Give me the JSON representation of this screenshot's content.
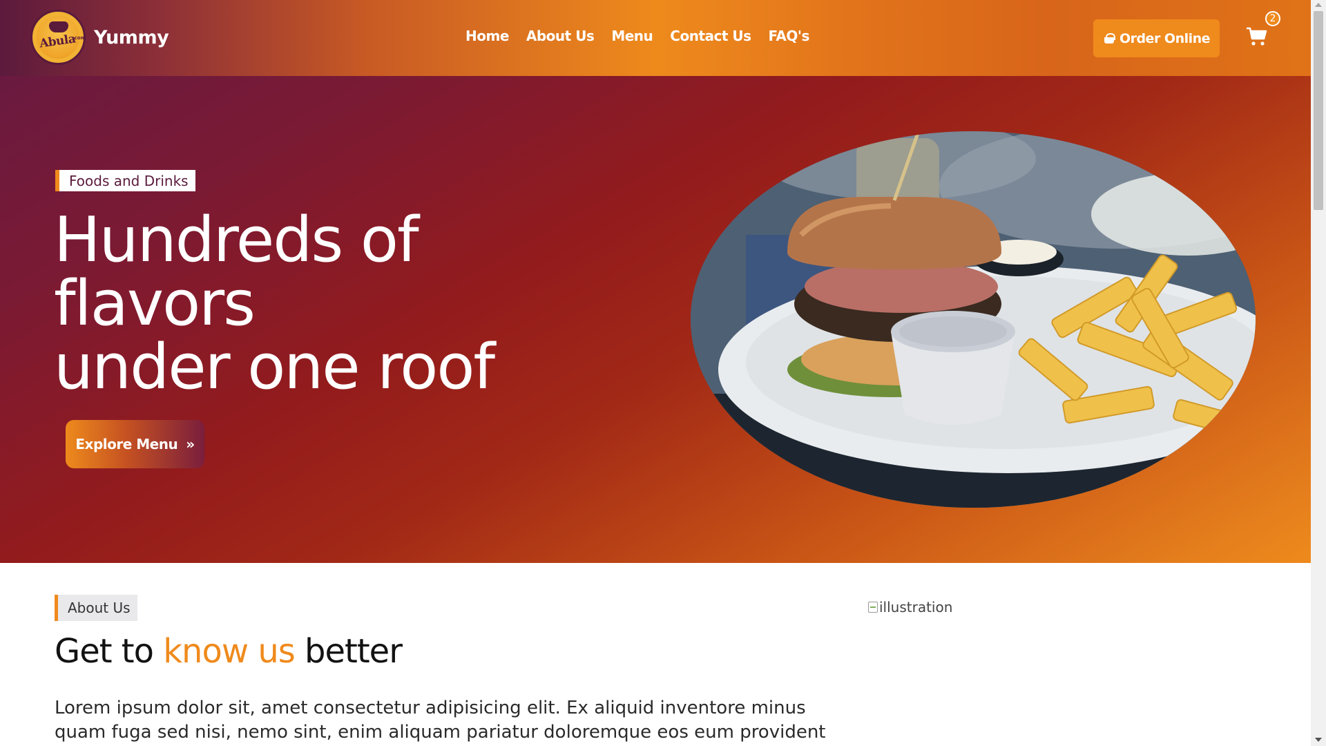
{
  "brand": {
    "name": "Yummy",
    "logo_text": "Abula",
    "logo_suffix": ".com"
  },
  "nav": {
    "items": [
      {
        "label": "Home"
      },
      {
        "label": "About Us"
      },
      {
        "label": "Menu"
      },
      {
        "label": "Contact Us"
      },
      {
        "label": "FAQ's"
      }
    ],
    "order_button": "Order Online",
    "cart_count": "2"
  },
  "hero": {
    "tag": "Foods and Drinks",
    "title_lines": [
      "Hundreds of",
      "flavors",
      "under one roof"
    ],
    "cta_label": "Explore Menu",
    "image_alt": "burger and fries"
  },
  "about": {
    "tag": "About Us",
    "title_start": "Get to ",
    "title_accent": "know us",
    "title_end": " better",
    "body": "Lorem ipsum dolor sit, amet consectetur adipisicing elit. Ex aliquid inventore minus quam fuga sed nisi, nemo sint, enim aliquam pariatur doloremque eos eum provident modi",
    "illustration_alt": "illustration"
  },
  "colors": {
    "accent": "#ef8a1c",
    "brand_dark": "#5a1a3c",
    "hero_red": "#931b1c"
  }
}
